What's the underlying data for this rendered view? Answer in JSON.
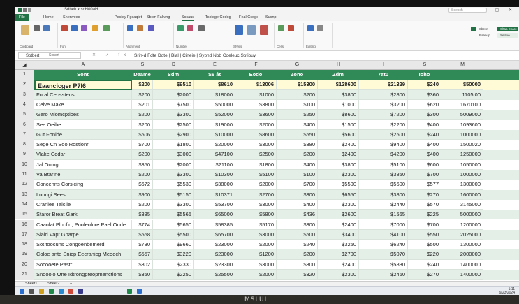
{
  "window": {
    "title": "Sdbeh x scH00aH",
    "search_placeholder": "Seecch",
    "win_controls": "– ▢ ✕"
  },
  "ribbon": {
    "tabs": [
      "File",
      "Home",
      "Snenvees",
      "Pecley Fgsaqiet",
      "Sbicn Faltvng",
      "Sccaus",
      "Tsolege Codog",
      "Feal Ccoge",
      "Sucnp"
    ],
    "active_tab": 5,
    "groups": [
      "Clipboard",
      "Font",
      "Alignment",
      "Number",
      "Styles",
      "Cells",
      "Editing"
    ],
    "right_buttons": [
      "Sbcvn",
      "Rsaeup",
      "Cltaa Ehare",
      "Selaxe"
    ]
  },
  "formula_bar": {
    "name_box": "Sotbert",
    "name_box_hint": "Sonert",
    "fx_icons": "✕ ✓ fx",
    "formula": "Srin-d   Fdte Dote | Bial | Cineie | Sypnd Nob Coeleuc Sofiouy"
  },
  "columns": [
    "A",
    "S",
    "D",
    "E",
    "F",
    "G",
    "H",
    "I",
    "S",
    "M"
  ],
  "header_row": [
    "Sönt",
    "Deame",
    "Sdm",
    "S6 åt",
    "Eodo",
    "Zöno",
    "Zdm",
    "7at0",
    "Iöho",
    ""
  ],
  "selected_row": [
    "Eaancicger P7I6",
    "$200",
    "$9510",
    "$8610",
    "$13006",
    "$15300",
    "$128600",
    "$21329",
    "$240",
    "$50000"
  ],
  "rows": [
    [
      "Foral Censstens",
      "$200",
      "$2000",
      "$18000",
      "$1000",
      "$200",
      "$3800",
      "$2800",
      "$360",
      "1105 00"
    ],
    [
      "Ceive Make",
      "$201",
      "$7500",
      "$50000",
      "$3800",
      "$100",
      "$1000",
      "$3200",
      "$620",
      "1670100"
    ],
    [
      "Gero Mlomcptioes",
      "$200",
      "$3300",
      "$52000",
      "$3600",
      "$250",
      "$8600",
      "$7200",
      "$300",
      "5009000"
    ],
    [
      "See Oeibe",
      "$200",
      "$2500",
      "$19000",
      "$2000",
      "$400",
      "$1500",
      "$2200",
      "$400",
      "1093600"
    ],
    [
      "Gut Fonide",
      "$506",
      "$2900",
      "$10000",
      "$8600",
      "$550",
      "$5600",
      "$2500",
      "$240",
      "1000000"
    ],
    [
      "Sege Cn Soo Rostionr",
      "$700",
      "$1800",
      "$20000",
      "$3000",
      "$380",
      "$2400",
      "$9400",
      "$400",
      "1500020"
    ],
    [
      "Vlake Codar",
      "$200",
      "$3000",
      "$47100",
      "$2500",
      "$200",
      "$2400",
      "$4200",
      "$400",
      "1250000"
    ],
    [
      "Jal Ooing",
      "$350",
      "$2000",
      "$21100",
      "$1800",
      "$400",
      "$3800",
      "$5100",
      "$600",
      "1050000"
    ],
    [
      "Va Btarine",
      "$200",
      "$3300",
      "$10300",
      "$5100",
      "$100",
      "$2300",
      "$3850",
      "$700",
      "1000000"
    ],
    [
      "Concenns Corsicing",
      "$672",
      "$5530",
      "$38000",
      "$2000",
      "$700",
      "$5500",
      "$5600",
      "$577",
      "1300000"
    ],
    [
      "Lonngi Sees",
      "$900",
      "$5150",
      "$10371",
      "$2700",
      "$300",
      "$6550",
      "$3800",
      "$270",
      "1600000"
    ],
    [
      "Cranlee Taiclie",
      "$200",
      "$3300",
      "$53700",
      "$3000",
      "$400",
      "$2300",
      "$2440",
      "$570",
      "3145000"
    ],
    [
      "Staror Breat Gark",
      "$385",
      "$5565",
      "$65000",
      "$5800",
      "$436",
      "$2600",
      "$1565",
      "$225",
      "5000000"
    ],
    [
      "Caanlat Plucfid, Pooleolure Pael Onde",
      "$774",
      "$5650",
      "$58385",
      "$5170",
      "$300",
      "$2400",
      "$7000",
      "$700",
      "1200000"
    ],
    [
      "Slald Vapt Gparpe",
      "$558",
      "$5500",
      "$65700",
      "$3000",
      "$500",
      "$3400",
      "$4100",
      "$550",
      "2025000"
    ],
    [
      "Sot toocuns Congoenbemerd",
      "$730",
      "$9660",
      "$23000",
      "$2000",
      "$240",
      "$3250",
      "$6240",
      "$500",
      "1300000"
    ],
    [
      "Coloe ante Snicp Eecranicg Meoech",
      "$557",
      "$3220",
      "$23000",
      "$1200",
      "$200",
      "$2700",
      "$5070",
      "$220",
      "2000000"
    ],
    [
      "Socooete Pastr",
      "$302",
      "$2330",
      "$23300",
      "$3000",
      "$300",
      "$2400",
      "$5830",
      "$240",
      "1400000"
    ],
    [
      "Snooolo One Idtrongpreopmenctions",
      "$350",
      "$2250",
      "$25500",
      "$2000",
      "$320",
      "$2300",
      "$2460",
      "$270",
      "1400000"
    ]
  ],
  "sheet_tabs": [
    "Sheet1",
    "Sheet2",
    "+"
  ],
  "taskbar": {
    "time": "1:11",
    "date": "9/23/2024"
  },
  "monitor_logo": "MSLUI",
  "colors": {
    "accent": "#217346",
    "header_green": "#2f8a57",
    "stripe": "#e4efe8",
    "selected_fill": "#fffbd6"
  }
}
